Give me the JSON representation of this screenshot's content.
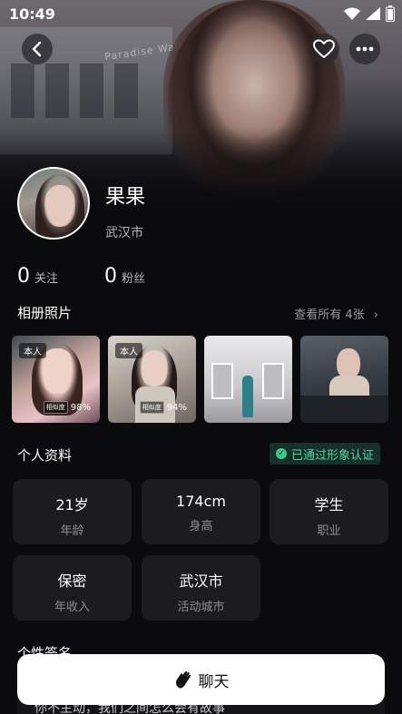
{
  "status_bar": {
    "time": "10:49"
  },
  "hero": {
    "sign_text": "Paradise Walk"
  },
  "profile": {
    "nickname": "果果",
    "city": "武汉市",
    "following_count": "0",
    "following_label": "关注",
    "followers_count": "0",
    "followers_label": "粉丝"
  },
  "album": {
    "title": "相册照片",
    "view_all": "查看所有 4张",
    "photos": [
      {
        "self_tag": "本人",
        "similarity_label": "相似度",
        "similarity": "98%"
      },
      {
        "self_tag": "本人",
        "similarity_label": "相似度",
        "similarity": "94%"
      },
      {
        "self_tag": "",
        "similarity_label": "",
        "similarity": ""
      },
      {
        "self_tag": "",
        "similarity_label": "",
        "similarity": ""
      }
    ]
  },
  "details": {
    "title": "个人资料",
    "verified": "已通过形象认证",
    "cards": [
      {
        "value": "21岁",
        "label": "年龄"
      },
      {
        "value": "174cm",
        "label": "身高"
      },
      {
        "value": "学生",
        "label": "职业"
      },
      {
        "value": "保密",
        "label": "年收入"
      },
      {
        "value": "武汉市",
        "label": "活动城市"
      }
    ]
  },
  "signature": {
    "title": "个性签名",
    "text": "你不主动，我们之间怎么会有故事"
  },
  "chat_button": {
    "label": "聊天"
  },
  "colors": {
    "accent_green": "#3ec88e",
    "card_bg": "#1c1c20",
    "page_bg": "#0b0b0d"
  }
}
